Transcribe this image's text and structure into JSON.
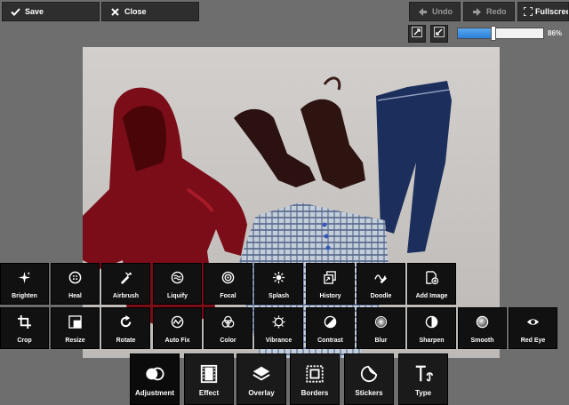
{
  "topbar": {
    "save_label": "Save",
    "close_label": "Close",
    "undo_label": "Undo",
    "redo_label": "Redo",
    "fullscreen_label": "Fullscreen"
  },
  "zoom": {
    "value_label": "86%",
    "slider_level_percent": 42
  },
  "tools_row1": [
    {
      "label": "Brighten",
      "icon": "sparkle-icon"
    },
    {
      "label": "Heal",
      "icon": "bandage-icon"
    },
    {
      "label": "Airbrush",
      "icon": "airbrush-icon"
    },
    {
      "label": "Liquify",
      "icon": "liquify-icon"
    },
    {
      "label": "Focal",
      "icon": "focal-icon"
    },
    {
      "label": "Splash",
      "icon": "splash-icon"
    },
    {
      "label": "History",
      "icon": "history-icon"
    },
    {
      "label": "Doodle",
      "icon": "doodle-icon"
    },
    {
      "label": "Add Image",
      "icon": "add-image-icon"
    }
  ],
  "tools_row2": [
    {
      "label": "Crop",
      "icon": "crop-icon"
    },
    {
      "label": "Resize",
      "icon": "resize-icon"
    },
    {
      "label": "Rotate",
      "icon": "rotate-icon"
    },
    {
      "label": "Auto Fix",
      "icon": "auto-fix-icon"
    },
    {
      "label": "Color",
      "icon": "color-icon"
    },
    {
      "label": "Vibrance",
      "icon": "vibrance-icon"
    },
    {
      "label": "Contrast",
      "icon": "contrast-icon"
    },
    {
      "label": "Blur",
      "icon": "blur-icon"
    },
    {
      "label": "Sharpen",
      "icon": "sharpen-icon"
    },
    {
      "label": "Smooth",
      "icon": "smooth-icon"
    },
    {
      "label": "Red Eye",
      "icon": "eye-icon"
    }
  ],
  "categories": [
    {
      "label": "Adjustment",
      "icon": "adjustment-icon",
      "active": true
    },
    {
      "label": "Effect",
      "icon": "film-icon"
    },
    {
      "label": "Overlay",
      "icon": "layers-icon"
    },
    {
      "label": "Borders",
      "icon": "border-frame-icon"
    },
    {
      "label": "Stickers",
      "icon": "sticker-icon"
    },
    {
      "label": "Type",
      "icon": "type-icon"
    }
  ],
  "colors": {
    "panel": "#111111",
    "background": "#6e6e6e",
    "accent": "#2b7fd6"
  }
}
